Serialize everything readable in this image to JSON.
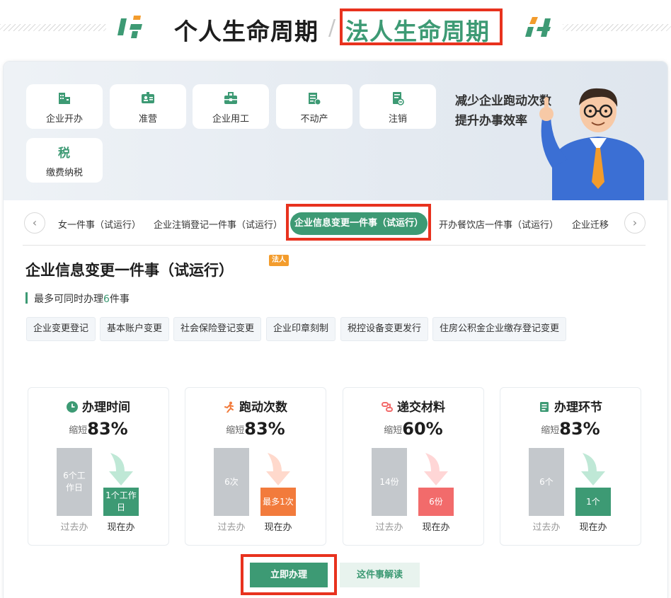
{
  "header": {
    "personal_title": "个人生命周期",
    "separator": "/",
    "legal_title": "法人生命周期"
  },
  "banner": {
    "categories": [
      {
        "label": "企业开办",
        "icon": "building-icon"
      },
      {
        "label": "准营",
        "icon": "license-card-icon"
      },
      {
        "label": "企业用工",
        "icon": "briefcase-icon"
      },
      {
        "label": "不动产",
        "icon": "property-doc-icon"
      },
      {
        "label": "注销",
        "icon": "cancel-doc-icon"
      },
      {
        "label": "缴费纳税",
        "icon": "tax-icon"
      }
    ],
    "slogan_line1": "减少企业跑动次数",
    "slogan_line2": "提升办事效率"
  },
  "tabs": {
    "prev": "‹",
    "next": "›",
    "items": [
      "女一件事（试运行）",
      "企业注销登记一件事（试运行）",
      "企业信息变更一件事（试运行）",
      "开办餐饮店一件事（试运行）",
      "企业迁移"
    ],
    "active_index": 2
  },
  "detail": {
    "title": "企业信息变更一件事（试运行）",
    "badge": "法人",
    "max_prefix": "最多可同时办理",
    "max_count": "6",
    "max_suffix": "件事",
    "items": [
      "企业变更登记",
      "基本账户变更",
      "社会保险登记变更",
      "企业印章刻制",
      "税控设备变更发行",
      "住房公积金企业缴存登记变更"
    ]
  },
  "stats": [
    {
      "title": "办理时间",
      "icon": "clock-icon",
      "prefix": "缩短",
      "percent": "83%",
      "past": "6个工作日",
      "now": "1个工作日",
      "now_color": "#3d9a74",
      "arrow_color": "#bfe8d6",
      "past_label": "过去办",
      "now_label": "现在办"
    },
    {
      "title": "跑动次数",
      "icon": "running-person-icon",
      "prefix": "缩短",
      "percent": "83%",
      "past": "6次",
      "now": "最多1次",
      "now_color": "#f27b3c",
      "arrow_color": "#ffd9cc",
      "past_label": "过去办",
      "now_label": "现在办"
    },
    {
      "title": "递交材料",
      "icon": "materials-icon",
      "prefix": "缩短",
      "percent": "60%",
      "past": "14份",
      "now": "6份",
      "now_color": "#f26b6b",
      "arrow_color": "#ffd6d6",
      "past_label": "过去办",
      "now_label": "现在办"
    },
    {
      "title": "办理环节",
      "icon": "checklist-icon",
      "prefix": "缩短",
      "percent": "83%",
      "past": "6个",
      "now": "1个",
      "now_color": "#3d9a74",
      "arrow_color": "#bfe8d6",
      "past_label": "过去办",
      "now_label": "现在办"
    }
  ],
  "actions": {
    "apply": "立即办理",
    "read": "这件事解读"
  },
  "colors": {
    "brand_green": "#3d9a74",
    "highlight_red": "#e8321e",
    "badge_orange": "#f39c2c"
  }
}
